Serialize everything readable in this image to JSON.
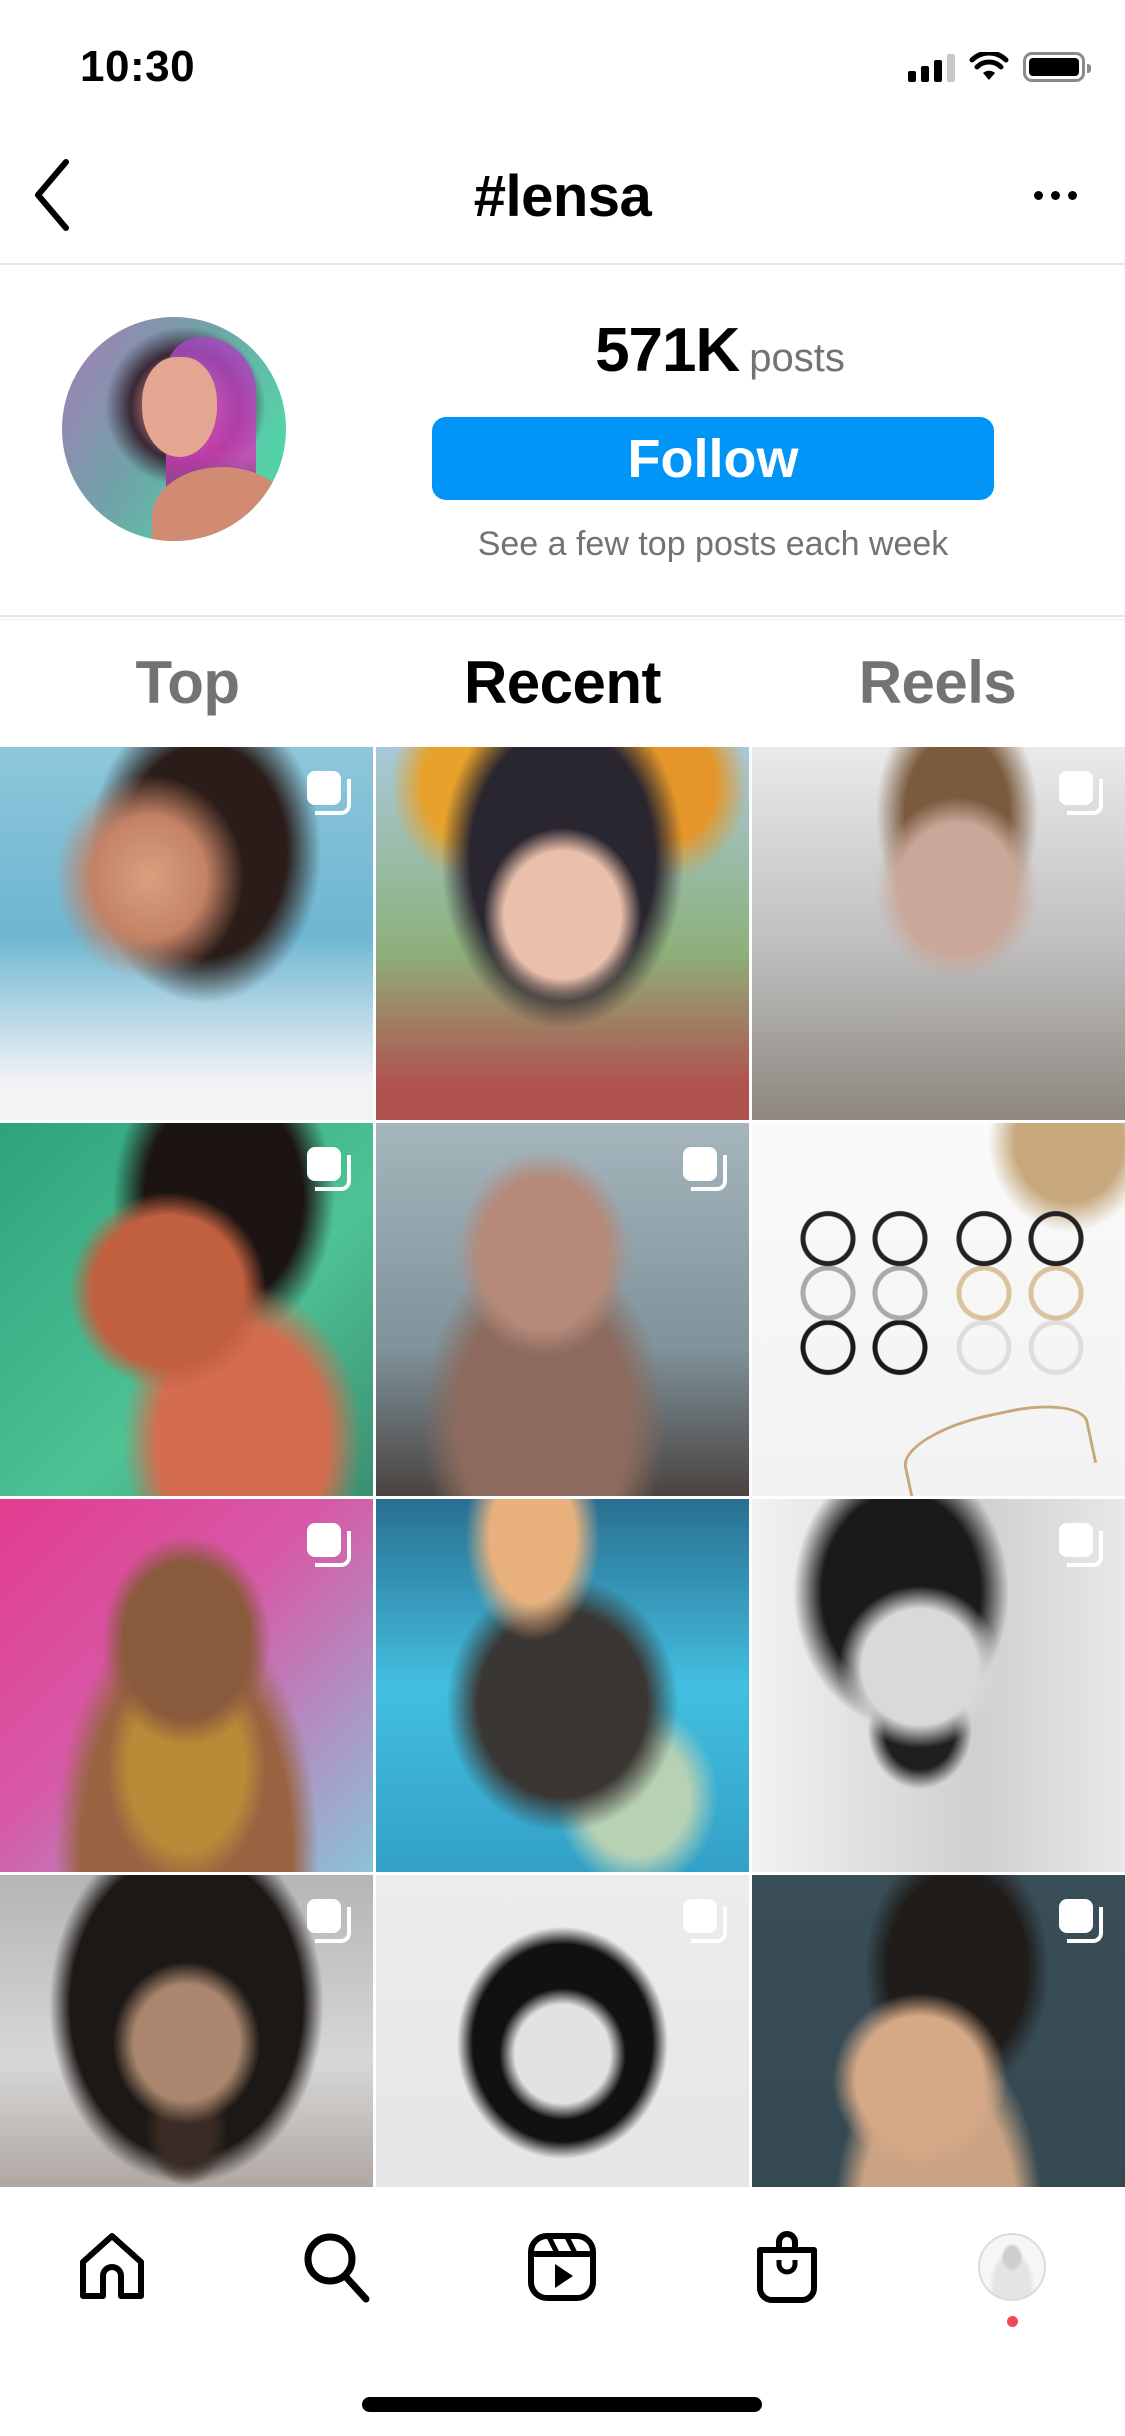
{
  "status_bar": {
    "time": "10:30",
    "signal_bars_active": 3,
    "signal_bars_total": 4,
    "icons": [
      "cellular-signal-icon",
      "wifi-icon",
      "battery-icon"
    ],
    "battery_level": 1.0
  },
  "header": {
    "title": "#lensa",
    "back_icon": "chevron-left-icon",
    "more_icon": "more-horizontal-icon"
  },
  "tag_info": {
    "avatar_alt": "Hashtag top post avatar",
    "posts_count": "571K",
    "posts_label": "posts",
    "follow_label": "Follow",
    "follow_subtitle": "See a few top posts each week",
    "follow_color": "#0095f6"
  },
  "tabs": [
    {
      "label": "Top",
      "active": false
    },
    {
      "label": "Recent",
      "active": true
    },
    {
      "label": "Reels",
      "active": false
    }
  ],
  "grid": {
    "posts": [
      {
        "description": "Woman with dark hair and earring, light blue background",
        "multiple": true
      },
      {
        "description": "Girl with flower crown",
        "multiple": false
      },
      {
        "description": "Young man with light brown hair",
        "multiple": true
      },
      {
        "description": "Woman portrait on green background",
        "multiple": true
      },
      {
        "description": "Bald man shirtless with chest tattoo",
        "multiple": true
      },
      {
        "description": "Six pairs of round eyeglasses with rope",
        "multiple": false
      },
      {
        "description": "Woman with gold jewelry on pink background",
        "multiple": true
      },
      {
        "description": "Futuristic armored woman with visor",
        "multiple": false
      },
      {
        "description": "Black and white sketch of bearded man with hood",
        "multiple": true
      },
      {
        "description": "Man with long curly hair",
        "multiple": true
      },
      {
        "description": "Black and white illustration of woman with long hair",
        "multiple": true
      },
      {
        "description": "Woman with dark hair in updo",
        "multiple": true
      }
    ]
  },
  "tab_bar": {
    "items": [
      {
        "name": "home",
        "icon": "home-icon"
      },
      {
        "name": "search",
        "icon": "search-icon"
      },
      {
        "name": "reels",
        "icon": "reels-icon"
      },
      {
        "name": "shop",
        "icon": "shopping-bag-icon"
      },
      {
        "name": "profile",
        "icon": "profile-avatar"
      }
    ],
    "profile_notification": true,
    "notification_color": "#ed4956"
  }
}
